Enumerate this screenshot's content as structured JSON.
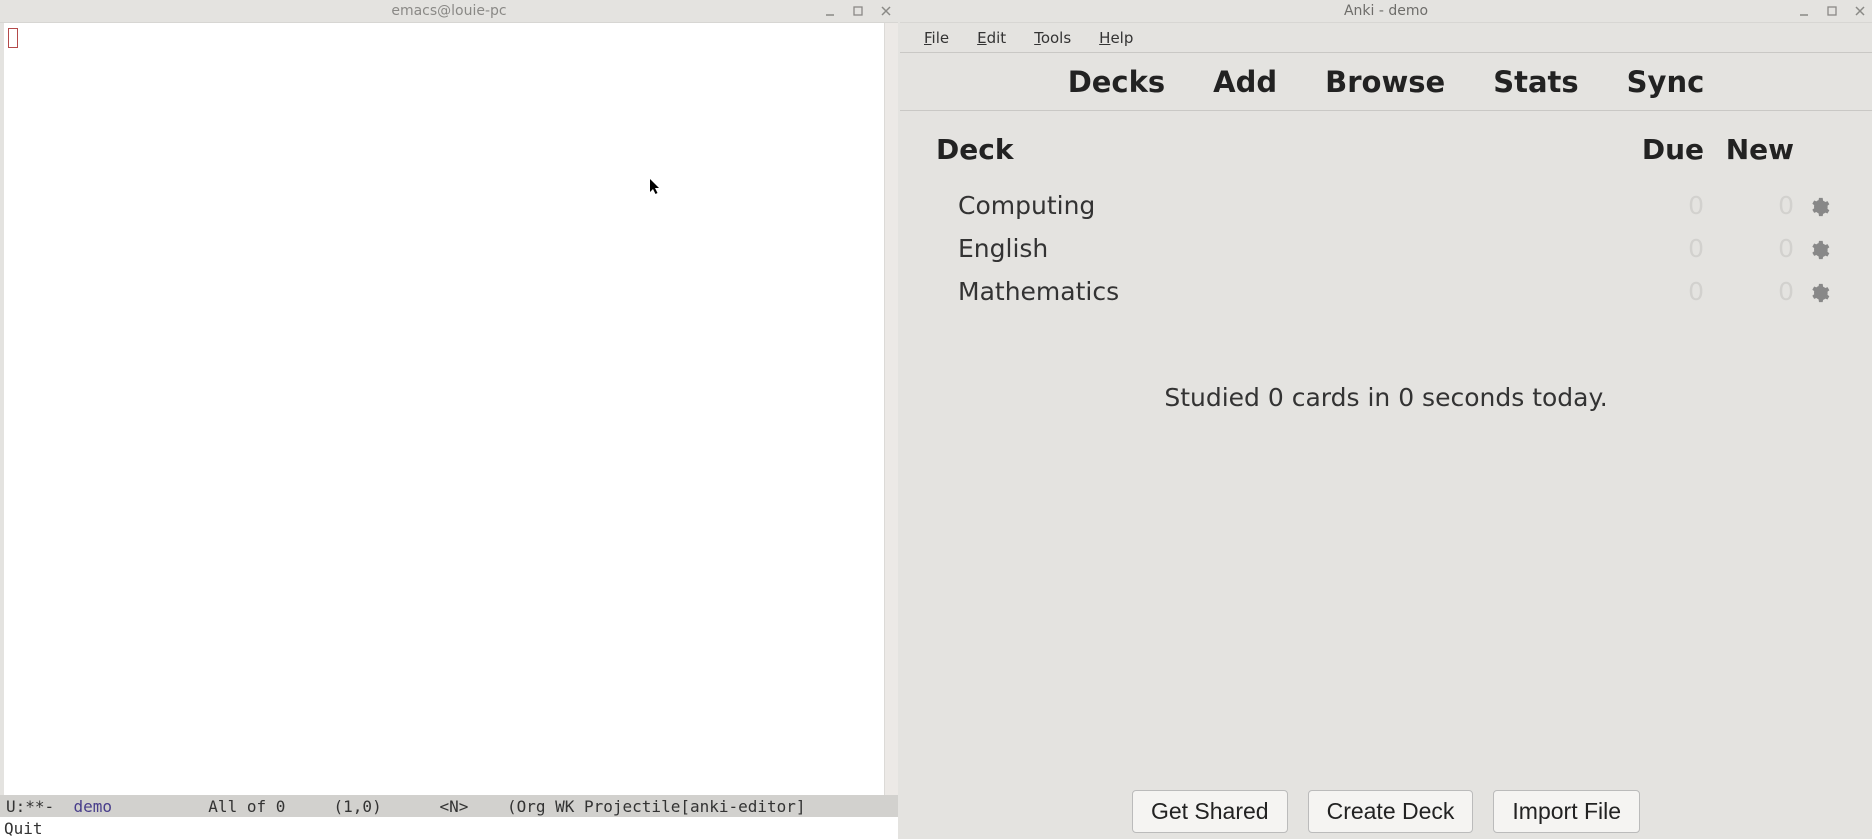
{
  "emacs": {
    "title": "emacs@louie-pc",
    "modeline": {
      "prefix": "U:**-  ",
      "buffer_name": "demo",
      "position": "All of 0",
      "line_col": "(1,0)",
      "state": "<N>",
      "modes": "(Org WK Projectile[anki-editor]"
    },
    "echo": "Quit"
  },
  "anki": {
    "title": "Anki - demo",
    "menu": {
      "items": [
        {
          "underline": "F",
          "rest": "ile"
        },
        {
          "underline": "E",
          "rest": "dit"
        },
        {
          "underline": "T",
          "rest": "ools"
        },
        {
          "underline": "H",
          "rest": "elp"
        }
      ]
    },
    "tabs": {
      "decks": "Decks",
      "add": "Add",
      "browse": "Browse",
      "stats": "Stats",
      "sync": "Sync"
    },
    "columns": {
      "deck": "Deck",
      "due": "Due",
      "new": "New"
    },
    "decks": [
      {
        "name": "Computing",
        "due": "0",
        "new": "0"
      },
      {
        "name": "English",
        "due": "0",
        "new": "0"
      },
      {
        "name": "Mathematics",
        "due": "0",
        "new": "0"
      }
    ],
    "status": "Studied 0 cards in 0 seconds today.",
    "footer": {
      "get_shared": "Get Shared",
      "create_deck": "Create Deck",
      "import_file": "Import File"
    }
  }
}
